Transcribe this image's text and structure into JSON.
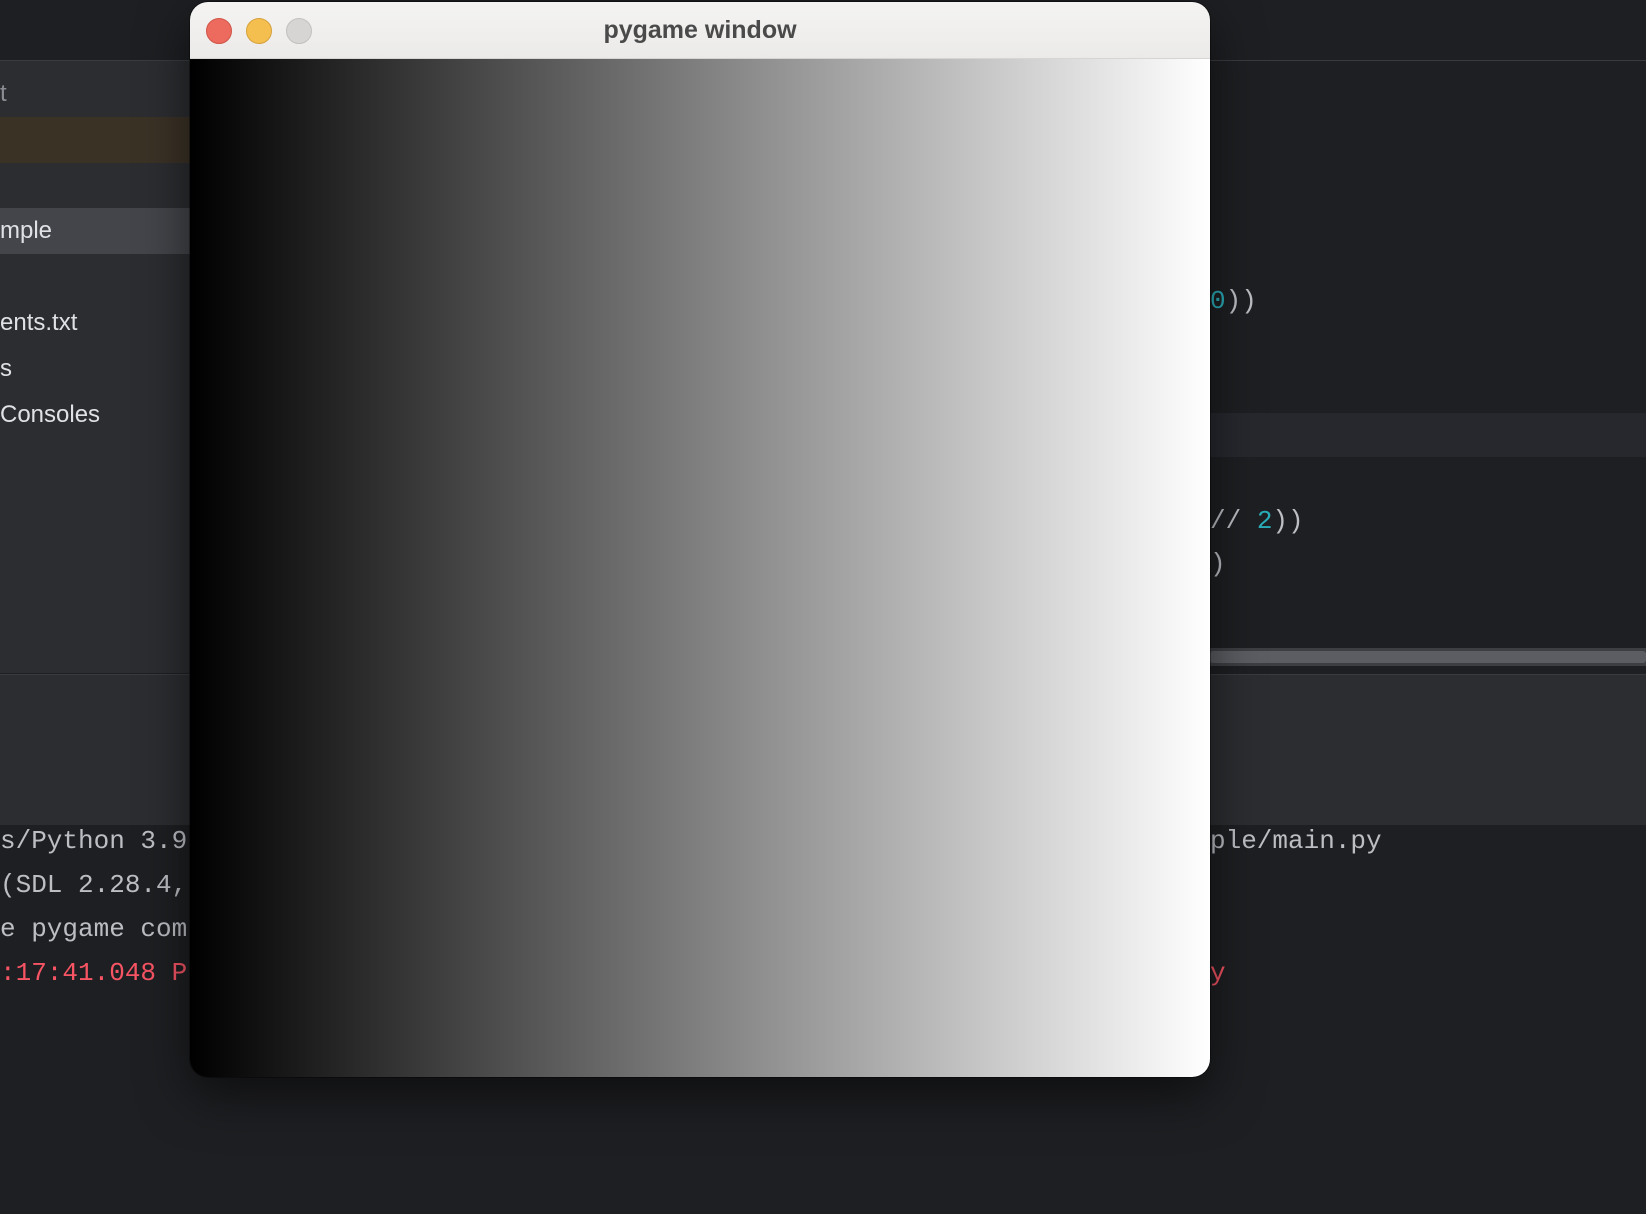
{
  "ide": {
    "sidebar": {
      "items": [
        {
          "label": "t"
        },
        {
          "label": ""
        },
        {
          "label": "mple"
        },
        {
          "label": "ents.txt"
        },
        {
          "label": "s"
        },
        {
          "label": "Consoles"
        }
      ]
    },
    "editor": {
      "lines": [
        {
          "code": "",
          "num": "0",
          "tail": "))"
        },
        {
          "code": "// ",
          "num": "2",
          "tail": "))"
        },
        {
          "code": ")",
          "num": "",
          "tail": ""
        }
      ]
    },
    "console": {
      "lines_left": [
        "s/Python 3.9",
        "(SDL 2.28.4,",
        "e pygame com",
        ":17:41.048 P"
      ],
      "line_right": "ple/main.py",
      "err_right": "y"
    }
  },
  "pygame": {
    "window_title": "pygame window",
    "gradient": {
      "from": "#000000",
      "to": "#ffffff",
      "direction": "left-to-right"
    }
  },
  "colors": {
    "ide_bg": "#1e1f22",
    "sidebar_bg": "#2b2d30",
    "number": "#2aacb8",
    "error": "#f75464",
    "close": "#ec6a5e",
    "minimize": "#f4bf4f",
    "zoom_disabled": "#d6d5d3"
  }
}
